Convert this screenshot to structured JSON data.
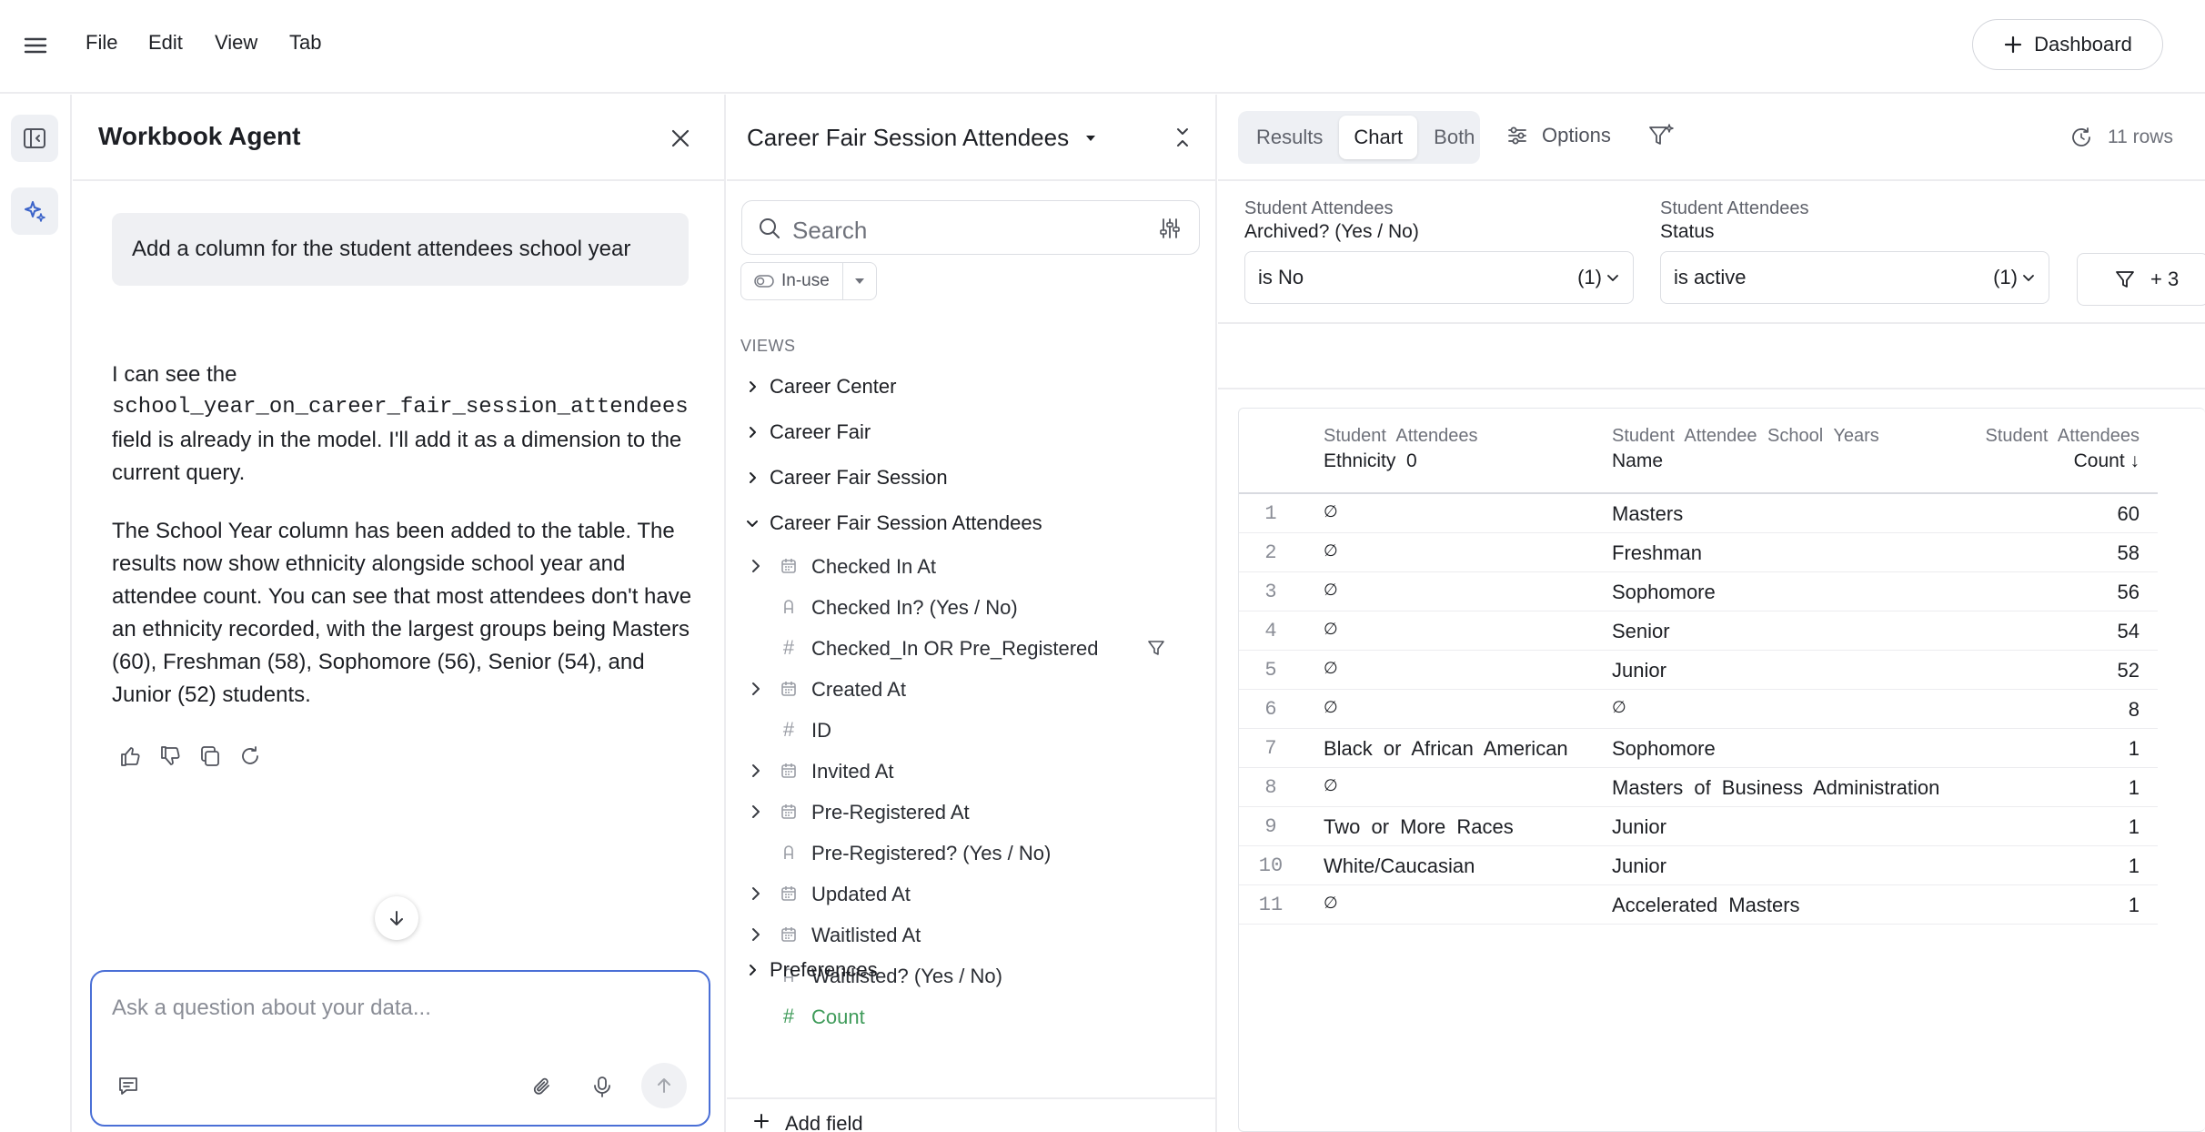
{
  "menubar": {
    "items": [
      "File",
      "Edit",
      "View",
      "Tab"
    ],
    "dashboard_button": "Dashboard"
  },
  "agent": {
    "title": "Workbook Agent",
    "user_message": "Add a column for the student attendees school year",
    "reply_p1_before": "I can see the",
    "reply_p1_code": "school_year_on_career_fair_session_attendees",
    "reply_p1_after": "field is already in the model. I'll add it as a dimension to the current query.",
    "reply_p2": "The School Year column has been added to the table. The results now show ethnicity alongside school year and attendee count. You can see that most attendees don't have an ethnicity recorded, with the largest groups being Masters (60), Freshman (58), Sophomore (56), Senior (54), and Junior (52) students.",
    "input_placeholder": "Ask a question about your data..."
  },
  "explorer": {
    "title": "Career Fair Session Attendees",
    "search_placeholder": "Search",
    "chip_label": "In-use",
    "views_label": "VIEWS",
    "views": [
      "Career Center",
      "Career Fair",
      "Career Fair Session",
      "Career Fair Session Attendees"
    ],
    "fields": [
      {
        "label": "Checked In At",
        "type": "date",
        "expandable": true
      },
      {
        "label": "Checked In? (Yes / No)",
        "type": "bool",
        "expandable": false
      },
      {
        "label": "Checked_In OR Pre_Registered",
        "type": "number",
        "expandable": false
      },
      {
        "label": "Created At",
        "type": "date",
        "expandable": true
      },
      {
        "label": "ID",
        "type": "number",
        "expandable": false
      },
      {
        "label": "Invited At",
        "type": "date",
        "expandable": true
      },
      {
        "label": "Pre-Registered At",
        "type": "date",
        "expandable": true
      },
      {
        "label": "Pre-Registered? (Yes / No)",
        "type": "bool",
        "expandable": false
      },
      {
        "label": "Updated At",
        "type": "date",
        "expandable": true
      },
      {
        "label": "Waitlisted At",
        "type": "date",
        "expandable": true
      },
      {
        "label": "Waitlisted? (Yes / No)",
        "type": "bool",
        "expandable": false
      },
      {
        "label": "Count",
        "type": "measure",
        "expandable": false
      }
    ],
    "after_views": [
      "Preferences"
    ],
    "add_field": "Add field"
  },
  "results": {
    "tabs": [
      "Results",
      "Chart",
      "Both"
    ],
    "active_tab": "Chart",
    "options_label": "Options",
    "row_count": "11 rows",
    "filters": [
      {
        "caption": "Student Attendees",
        "field": "Archived? (Yes / No)",
        "value": "is No",
        "count": "(1)"
      },
      {
        "caption": "Student Attendees",
        "field": "Status",
        "value": "is active",
        "count": "(1)"
      }
    ],
    "more_filters": "+ 3",
    "columns": [
      {
        "view": "Student Attendees",
        "field": "Ethnicity",
        "extra": "0"
      },
      {
        "view": "Student Attendee School Years",
        "field": "Name",
        "extra": ""
      },
      {
        "view": "Student Attendees",
        "field": "Count",
        "extra": "↓"
      }
    ],
    "null_symbol": "∅",
    "rows": [
      [
        "1",
        null,
        "Masters",
        "60"
      ],
      [
        "2",
        null,
        "Freshman",
        "58"
      ],
      [
        "3",
        null,
        "Sophomore",
        "56"
      ],
      [
        "4",
        null,
        "Senior",
        "54"
      ],
      [
        "5",
        null,
        "Junior",
        "52"
      ],
      [
        "6",
        null,
        null,
        "8"
      ],
      [
        "7",
        "Black or African American",
        "Sophomore",
        "1"
      ],
      [
        "8",
        null,
        "Masters of Business Administration",
        "1"
      ],
      [
        "9",
        "Two or More Races",
        "Junior",
        "1"
      ],
      [
        "10",
        "White/Caucasian",
        "Junior",
        "1"
      ],
      [
        "11",
        null,
        "Accelerated Masters",
        "1"
      ]
    ]
  }
}
